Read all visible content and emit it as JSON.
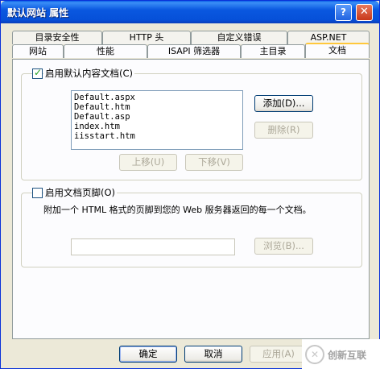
{
  "window": {
    "title": "默认网站 属性",
    "help_glyph": "?",
    "close_glyph": "✕"
  },
  "tabs_row1": [
    "目录安全性",
    "HTTP 头",
    "自定义错误",
    "ASP.NET"
  ],
  "tabs_row2": [
    "网站",
    "性能",
    "ISAPI 筛选器",
    "主目录",
    "文档"
  ],
  "active_tab": "文档",
  "default_content": {
    "checkbox_label": "启用默认内容文档(C)",
    "checked": true,
    "documents": [
      "Default.aspx",
      "Default.htm",
      "Default.asp",
      "index.htm",
      "iisstart.htm"
    ],
    "add_button": "添加(D)...",
    "remove_button": "删除(R)",
    "move_up_button": "上移(U)",
    "move_down_button": "下移(V)"
  },
  "footer_section": {
    "checkbox_label": "启用文档页脚(O)",
    "checked": false,
    "description": "附加一个 HTML 格式的页脚到您的 Web 服务器返回的每一个文档。",
    "footer_value": "",
    "browse_button": "浏览(B)..."
  },
  "buttons": {
    "ok": "确定",
    "cancel": "取消",
    "apply": "应用(A)"
  },
  "watermark": {
    "logo_glyph": "✕",
    "text": "创新互联"
  }
}
